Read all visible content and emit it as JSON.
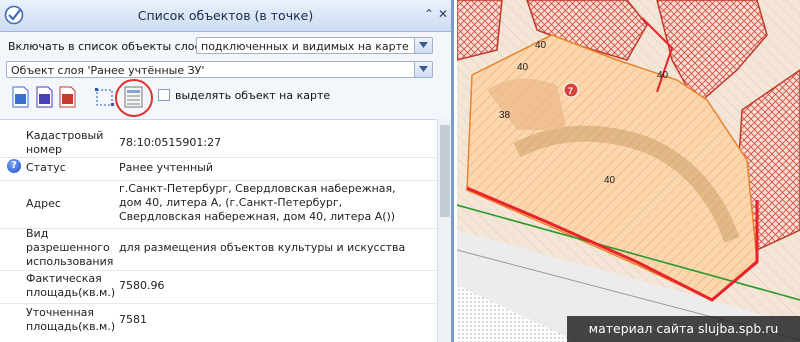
{
  "window": {
    "title": "Список объектов (в точке)",
    "collapse_glyph": "⌃",
    "close_glyph": "✕"
  },
  "layer_filter": {
    "label": "Включать в список объекты слоев:",
    "value": "подключенных и видимых на карте"
  },
  "object_select": {
    "value": "Объект слоя 'Ранее учтённые ЗУ'"
  },
  "toolbar": {
    "buttons": [
      "doc-blue-icon",
      "doc-purple-icon",
      "doc-red-icon",
      "select-frame-icon",
      "table-list-icon"
    ],
    "highlight_label": "выделять объект на карте"
  },
  "properties": [
    {
      "key": "Кадастровый\nномер",
      "value": "78:10:0515901:27"
    },
    {
      "key": "Статус",
      "value": "Ранее учтенный"
    },
    {
      "key": "Адрес",
      "value": "г.Санкт-Петербург, Свердловская набережная, дом 40, литера А, (г.Санкт-Петербург, Свердловская набережная, дом 40, литера А())"
    },
    {
      "key": "Вид\nразрешенного\nиспользования",
      "value": "для размещения объектов культуры и искусства"
    },
    {
      "key": "Фактическая\nплощадь(кв.м.)",
      "value": "7580.96"
    },
    {
      "key": "Уточненная\nплощадь(кв.м.)",
      "value": "7581"
    }
  ],
  "map": {
    "labels": [
      "40",
      "40",
      "40",
      "38",
      "40"
    ],
    "marker": "7",
    "colors": {
      "selection": "#e8232a",
      "fill": "#f8c9a0",
      "hatch": "#e8a060",
      "road": "#2a9a2a"
    }
  },
  "watermark": "материал сайта slujba.spb.ru"
}
